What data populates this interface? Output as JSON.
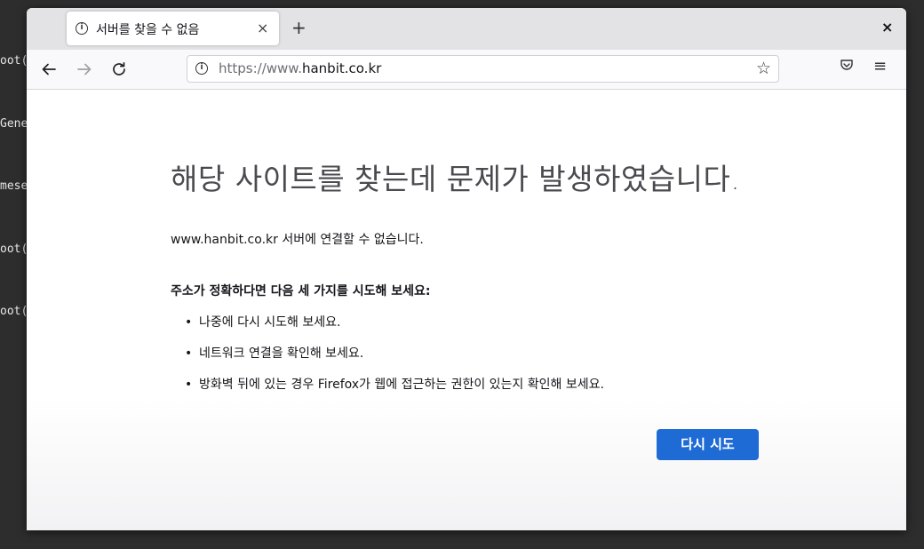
{
  "terminal": {
    "lines": [
      "oot(",
      "Gene",
      "mese",
      "oot(",
      "oot("
    ]
  },
  "browser": {
    "tab_title": "서버를 찾을 수 없음",
    "tab_close_glyph": "×",
    "new_tab_glyph": "+",
    "window_close_glyph": "×",
    "url": {
      "prefix": "https://www.",
      "domain": "hanbit.co.kr"
    },
    "icons": {
      "back": "arrow-left-icon",
      "forward": "arrow-right-icon",
      "reload": "reload-icon",
      "info": "info-icon",
      "bookmark": "star-icon",
      "pocket": "pocket-icon",
      "menu": "hamburger-menu-icon"
    }
  },
  "error_page": {
    "heading": "해당 사이트를 찾는데 문제가 발생하였습니다.",
    "description": "www.hanbit.co.kr 서버에 연결할 수 없습니다.",
    "subheading": "주소가 정확하다면 다음 세 가지를 시도해 보세요:",
    "tips": [
      "나중에 다시 시도해 보세요.",
      "네트워크 연결을 확인해 보세요.",
      "방화벽 뒤에 있는 경우 Firefox가 웹에 접근하는 권한이 있는지 확인해 보세요."
    ],
    "retry_label": "다시 시도"
  },
  "colors": {
    "accent": "#1e6bd6",
    "terminal_bg": "#2d2d2d"
  }
}
